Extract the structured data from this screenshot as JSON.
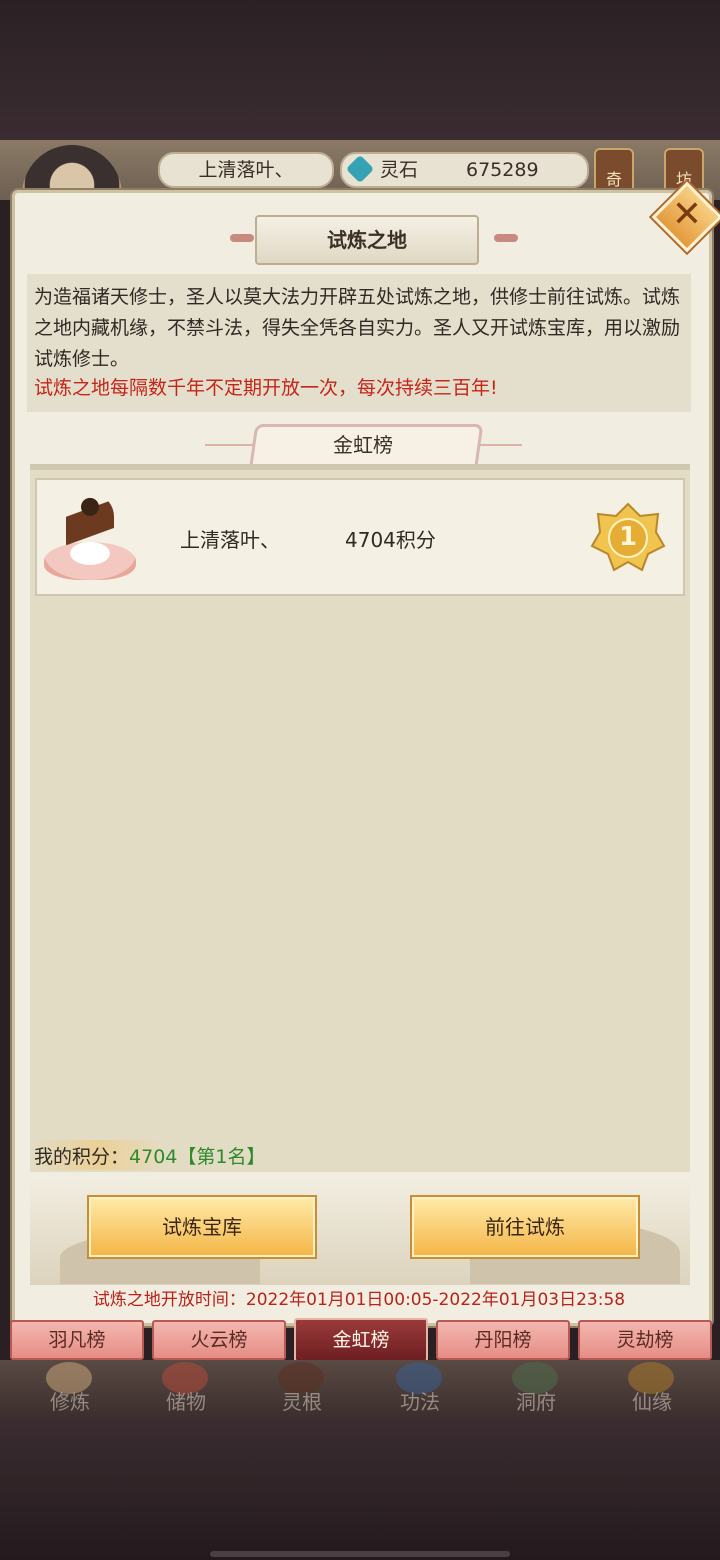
{
  "header": {
    "player_name": "上清落叶、",
    "currency_label": "灵石",
    "currency_value": "675289",
    "side_tabs": [
      "奇",
      "坊"
    ]
  },
  "dialog": {
    "title": "试炼之地",
    "description": "为造福诸天修士，圣人以莫大法力开辟五处试炼之地，供修士前往试炼。试炼之地内藏机缘，不禁斗法，得失全凭各自实力。圣人又开试炼宝库，用以激励试炼修士。",
    "notice": "试炼之地每隔数千年不定期开放一次，每次持续三百年!",
    "close_icon": "close-icon"
  },
  "ranking": {
    "title": "金虹榜",
    "rows": [
      {
        "name": "上清落叶、",
        "score": "4704积分",
        "rank": "1"
      }
    ],
    "my_score_label": "我的积分：",
    "my_score_value": "4704【第1名】"
  },
  "buttons": {
    "treasury": "试炼宝库",
    "go_trial": "前往试炼"
  },
  "open_time": "试炼之地开放时间：2022年01月01日00:05-2022年01月03日23:58",
  "tabs": [
    {
      "label": "羽凡榜",
      "active": false
    },
    {
      "label": "火云榜",
      "active": false
    },
    {
      "label": "金虹榜",
      "active": true
    },
    {
      "label": "丹阳榜",
      "active": false
    },
    {
      "label": "灵劫榜",
      "active": false
    }
  ],
  "bottom_nav": [
    "修炼",
    "储物",
    "灵根",
    "功法",
    "洞府",
    "仙缘"
  ],
  "colors": {
    "notice_red": "#c52418",
    "score_green": "#2e8a2a",
    "button_gold": "#f4b648",
    "active_tab": "#6e1e22"
  }
}
